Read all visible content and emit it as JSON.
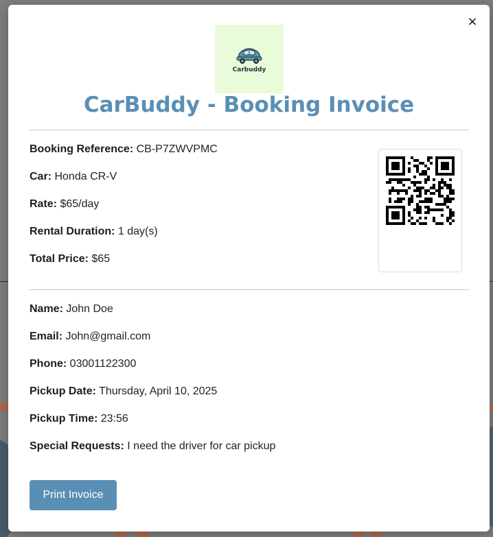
{
  "colors": {
    "accent": "#5a8fb5",
    "logo_bg": "#e9fbd8"
  },
  "modal": {
    "close_icon": "×",
    "logo_text": "Carbuddy",
    "title": "CarBuddy - Booking Invoice"
  },
  "booking": {
    "reference_label": "Booking Reference:",
    "reference_value": "CB-P7ZWVPMC",
    "car_label": "Car:",
    "car_value": "Honda CR-V",
    "rate_label": "Rate:",
    "rate_value": "$65/day",
    "duration_label": "Rental Duration:",
    "duration_value": "1 day(s)",
    "total_label": "Total Price:",
    "total_value": "$65"
  },
  "customer": {
    "name_label": "Name:",
    "name_value": "John Doe",
    "email_label": "Email:",
    "email_value": "John@gmail.com",
    "phone_label": "Phone:",
    "phone_value": "03001122300",
    "pickup_date_label": "Pickup Date:",
    "pickup_date_value": "Thursday, April 10, 2025",
    "pickup_time_label": "Pickup Time:",
    "pickup_time_value": "23:56",
    "requests_label": "Special Requests:",
    "requests_value": "I need the driver for car pickup"
  },
  "actions": {
    "print_label": "Print Invoice"
  }
}
